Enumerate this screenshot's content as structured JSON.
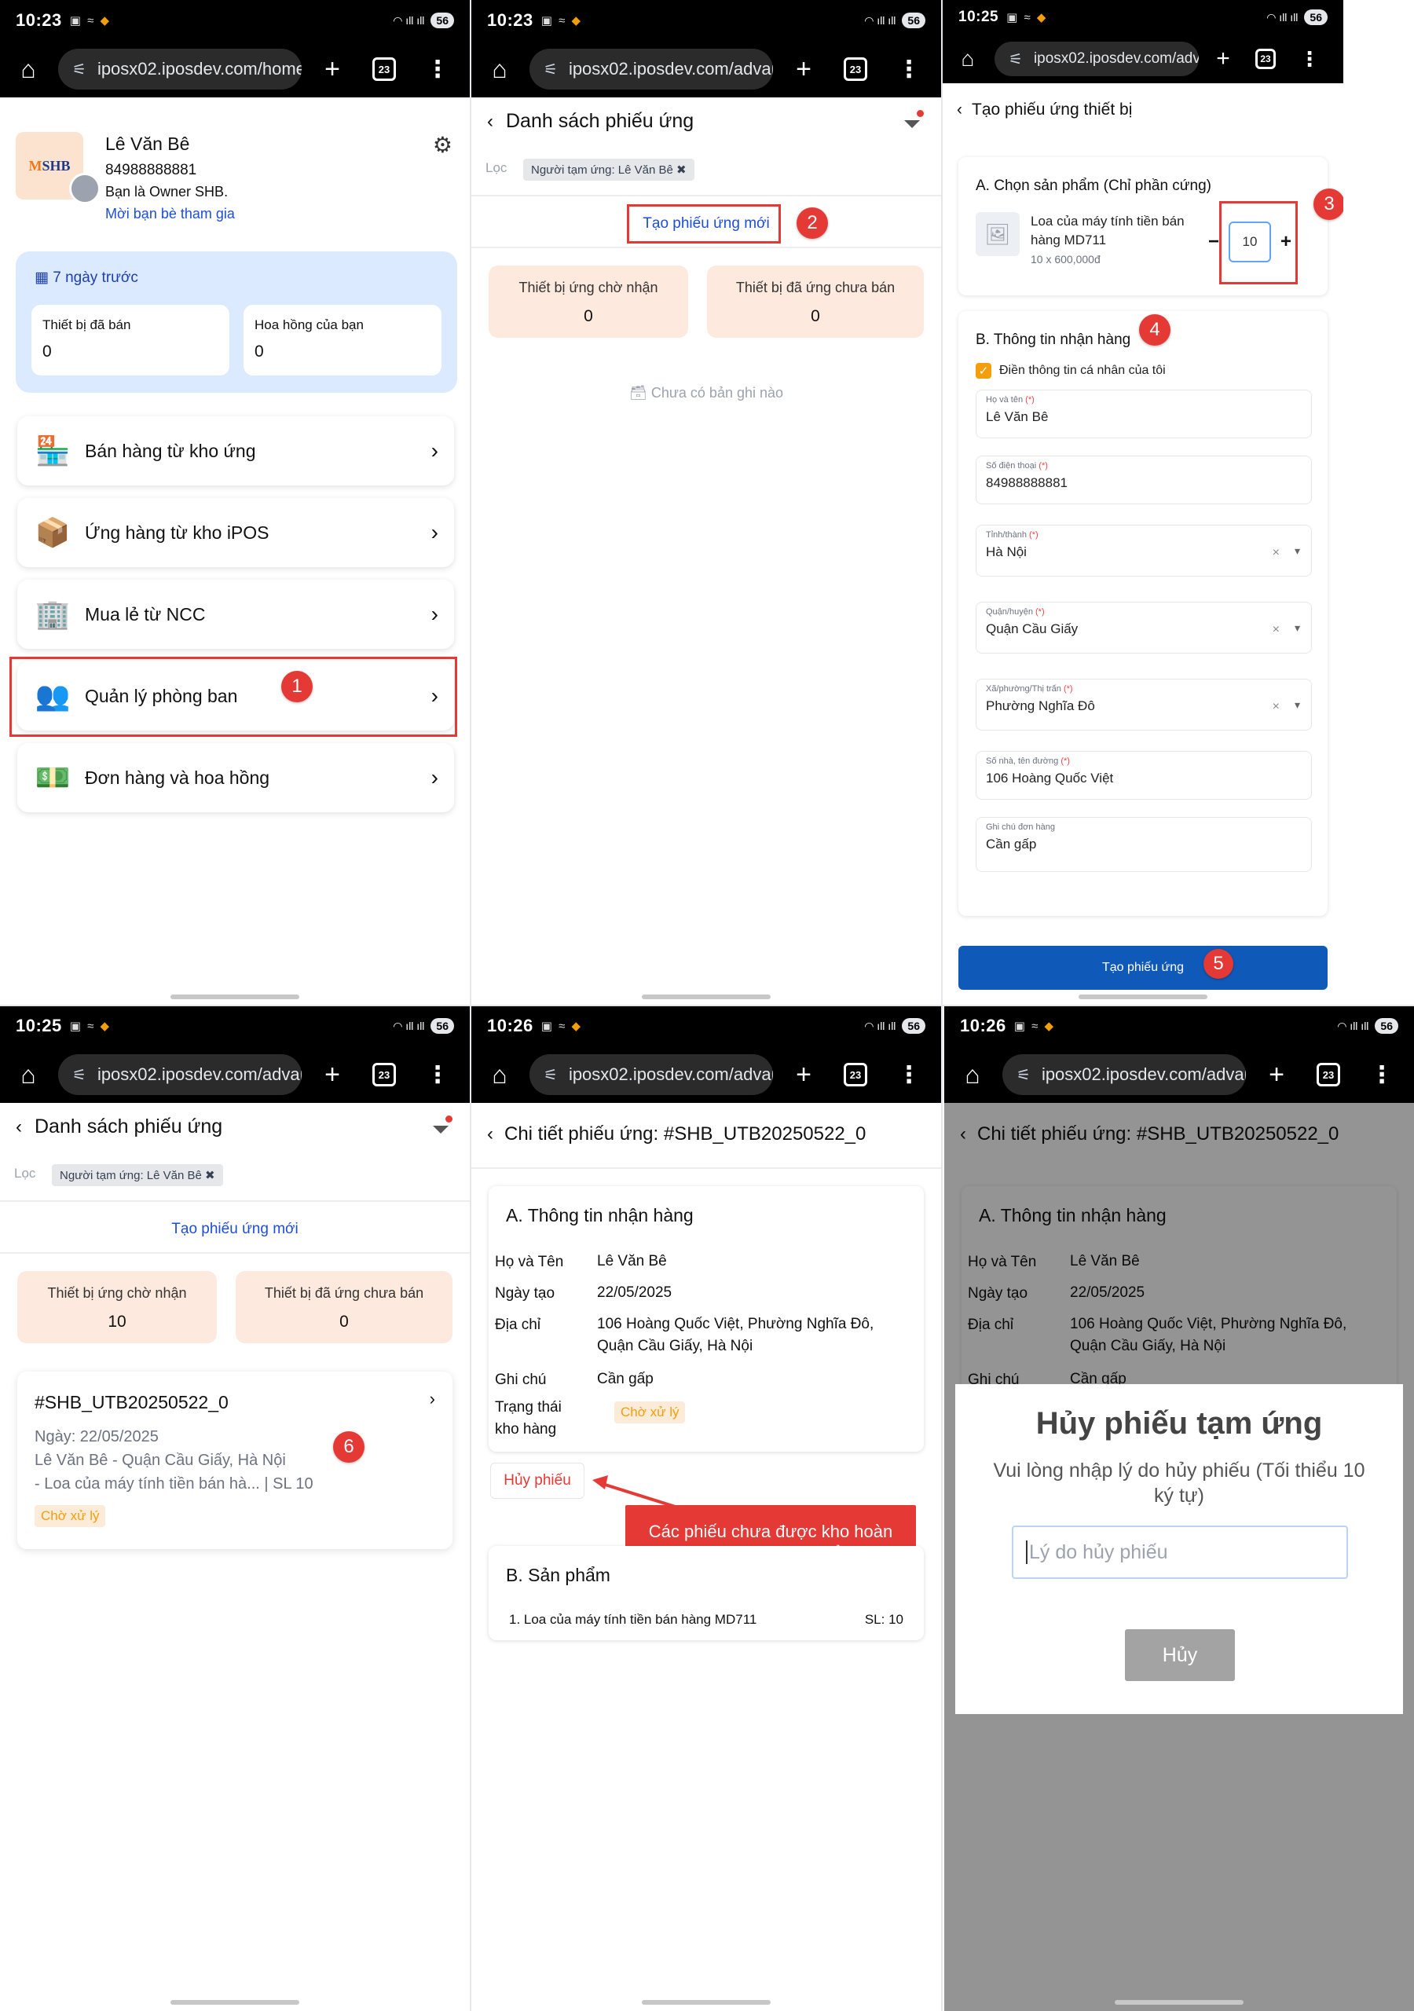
{
  "p1": {
    "time": "10:23",
    "battery": "56",
    "url": "iposx02.iposdev.com/home",
    "tabs": "23",
    "profile": {
      "name": "Lê Văn Bê",
      "phone": "84988888881",
      "role": "Bạn là Owner SHB.",
      "invite": "Mời bạn bè tham gia",
      "logo": "SHB"
    },
    "period": "7 ngày trước",
    "stats": [
      {
        "label": "Thiết bị đã bán",
        "value": "0"
      },
      {
        "label": "Hoa hồng của bạn",
        "value": "0"
      }
    ],
    "menu": [
      {
        "label": "Bán hàng từ kho ứng",
        "icon": "warehouse-cart-icon"
      },
      {
        "label": "Ứng hàng từ kho iPOS",
        "icon": "box-clipboard-icon"
      },
      {
        "label": "Mua lẻ từ NCC",
        "icon": "building-cart-icon"
      },
      {
        "label": "Quản lý phòng ban",
        "icon": "people-org-icon"
      },
      {
        "label": "Đơn hàng và hoa hồng",
        "icon": "order-money-icon"
      }
    ],
    "badge": "1"
  },
  "p2": {
    "time": "10:23",
    "battery": "56",
    "url": "iposx02.iposdev.com/advance",
    "tabs": "23",
    "title": "Danh sách phiếu ứng",
    "filter_label": "Lọc",
    "filter_chip": "Người tạm ứng: Lê Văn Bê ✖",
    "create": "Tạo phiếu ứng mới",
    "cards": [
      {
        "label": "Thiết bị ứng chờ nhận",
        "value": "0"
      },
      {
        "label": "Thiết bị đã ứng chưa bán",
        "value": "0"
      }
    ],
    "empty": "Chưa có bản ghi nào",
    "badge": "2"
  },
  "p3": {
    "time": "10:25",
    "battery": "56",
    "url": "iposx02.iposdev.com/advance",
    "tabs": "23",
    "title": "Tạo phiếu ứng thiết bị",
    "secA": "A. Chọn sản phẩm (Chỉ phần cứng)",
    "product": {
      "name": "Loa của máy tính tiền bán hàng MD711",
      "price": "10 x 600,000đ",
      "qty": "10"
    },
    "secB": "B. Thông tin nhận hàng",
    "checkbox": "Điền thông tin cá nhân của tôi",
    "fields": [
      {
        "label": "Họ và tên",
        "req": "(*)",
        "value": "Lê Văn Bê"
      },
      {
        "label": "Số điện thoại",
        "req": "(*)",
        "value": "84988888881"
      },
      {
        "label": "Tỉnh/thành",
        "req": "(*)",
        "value": "Hà Nội"
      },
      {
        "label": "Quận/huyện",
        "req": "(*)",
        "value": "Quận Cầu Giấy"
      },
      {
        "label": "Xã/phường/Thị trấn",
        "req": "(*)",
        "value": "Phường Nghĩa Đô"
      },
      {
        "label": "Số nhà, tên đường",
        "req": "(*)",
        "value": "106 Hoàng Quốc Việt"
      },
      {
        "label": "Ghi chú đơn hàng",
        "req": "",
        "value": "Cần gấp"
      }
    ],
    "submit": "Tạo phiếu ứng",
    "badges": [
      "3",
      "4",
      "5"
    ]
  },
  "p4": {
    "time": "10:25",
    "battery": "56",
    "url": "iposx02.iposdev.com/advance",
    "tabs": "23",
    "title": "Danh sách phiếu ứng",
    "filter_label": "Lọc",
    "filter_chip": "Người tạm ứng: Lê Văn Bê ✖",
    "create": "Tạo phiếu ứng mới",
    "cards": [
      {
        "label": "Thiết bị ứng chờ nhận",
        "value": "10"
      },
      {
        "label": "Thiết bị đã ứng chưa bán",
        "value": "0"
      }
    ],
    "order": {
      "code": "#SHB_UTB20250522_0",
      "date": "Ngày: 22/05/2025",
      "addr": "Lê Văn Bê - Quận Cầu Giấy, Hà Nội",
      "item": "- Loa của máy tính tiền bán hà... | SL 10",
      "status": "Chờ xử lý"
    },
    "badge": "6"
  },
  "p5": {
    "time": "10:26",
    "battery": "56",
    "url": "iposx02.iposdev.com/advance",
    "tabs": "23",
    "title": "Chi tiết phiếu ứng: #SHB_UTB20250522_0",
    "secA": "A. Thông tin nhận hàng",
    "rows": {
      "name_k": "Họ và Tên",
      "name_v": "Lê Văn Bê",
      "date_k": "Ngày tạo",
      "date_v": "22/05/2025",
      "addr_k": "Địa chỉ",
      "addr_v": "106 Hoàng Quốc Việt, Phường Nghĩa Đô, Quận Cầu Giấy, Hà Nội",
      "note_k": "Ghi chú",
      "note_v": "Cần gấp",
      "status_k": "Trạng thái kho hàng",
      "status_v": "Chờ xử lý"
    },
    "cancel": "Hủy phiếu",
    "callout": "Các phiếu chưa được kho hoàn thành người tạo có thể Hủy",
    "secB": "B. Sản phẩm",
    "item": "1. Loa của máy tính tiền bán hàng MD711",
    "item_sl": "SL: 10"
  },
  "p6": {
    "time": "10:26",
    "battery": "56",
    "url": "iposx02.iposdev.com/advance",
    "tabs": "23",
    "title": "Chi tiết phiếu ứng: #SHB_UTB20250522_0",
    "secA": "A. Thông tin nhận hàng",
    "rows": {
      "name_k": "Họ và Tên",
      "name_v": "Lê Văn Bê",
      "date_k": "Ngày tạo",
      "date_v": "22/05/2025",
      "addr_k": "Địa chỉ",
      "addr_v": "106 Hoàng Quốc Việt, Phường Nghĩa Đô, Quận Cầu Giấy, Hà Nội",
      "note_k": "Ghi chú",
      "note_v": "Cần gấp"
    },
    "modal": {
      "title": "Hủy phiếu tạm ứng",
      "desc": "Vui lòng nhập lý do hủy phiếu (Tối thiểu 10 ký tự)",
      "placeholder": "Lý do hủy phiếu",
      "button": "Hủy"
    }
  },
  "colors": {
    "accent_blue": "#0f5ab8",
    "link_blue": "#1d4ed8",
    "annotation_red": "#e53935",
    "status_orange": "#f59e0b",
    "card_peach": "#fde9dd"
  }
}
